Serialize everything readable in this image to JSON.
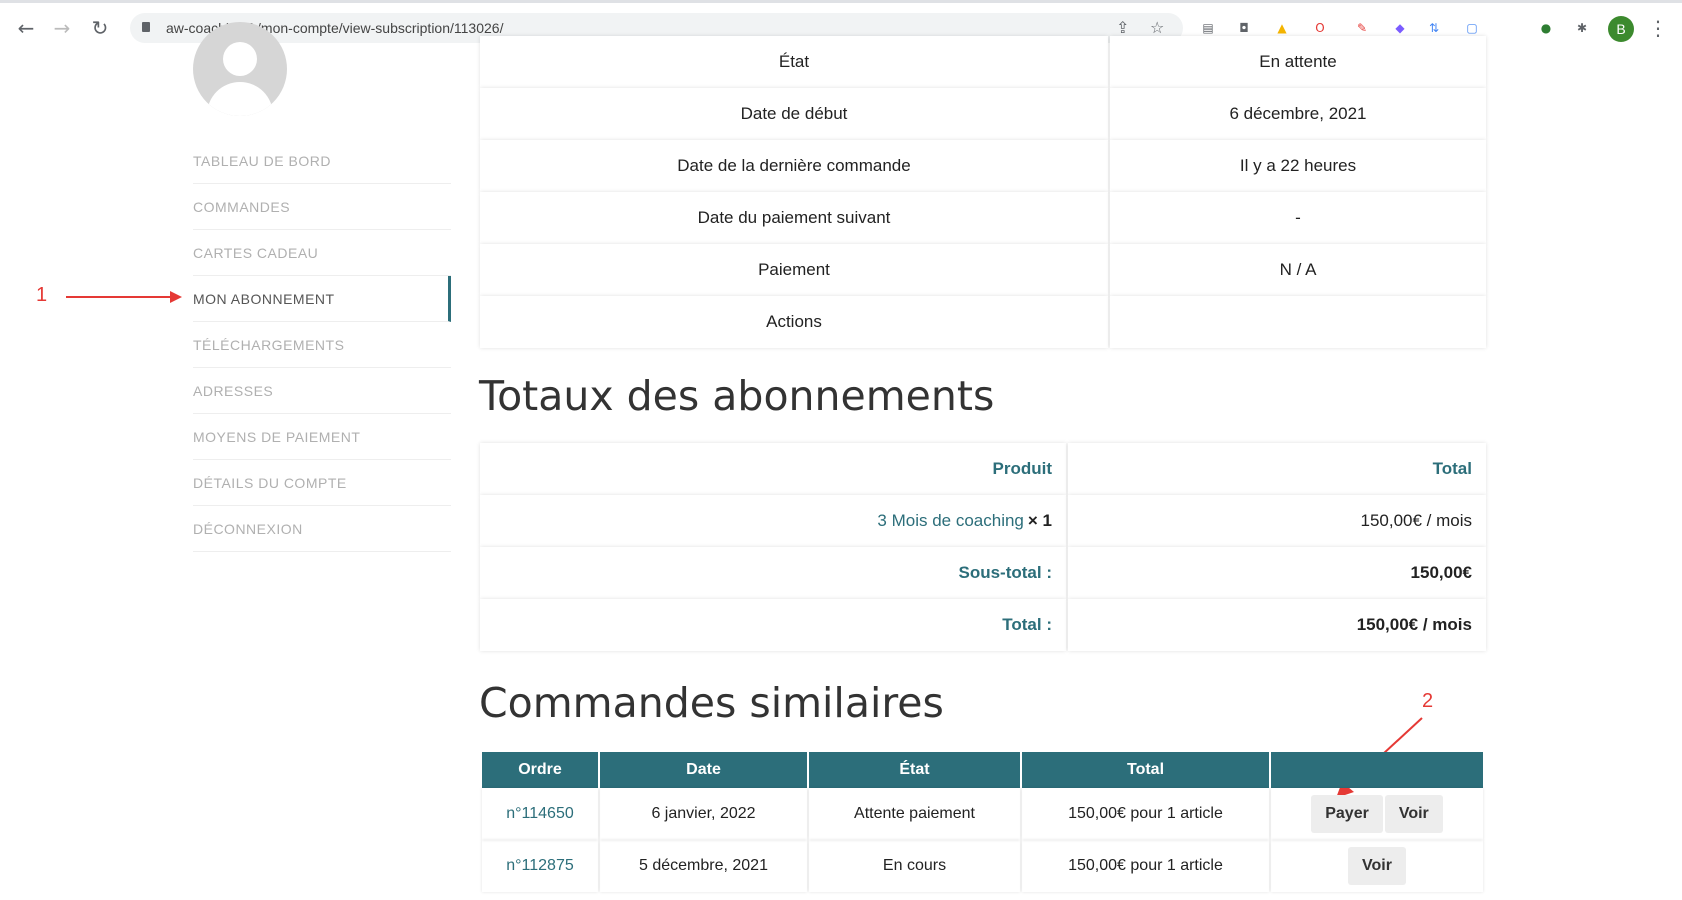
{
  "browser": {
    "url": "aw-coaching.fr/mon-compte/view-subscription/113026/",
    "profile_initial": "B"
  },
  "sidebar": {
    "items": [
      {
        "label": "TABLEAU DE BORD"
      },
      {
        "label": "COMMANDES"
      },
      {
        "label": "CARTES CADEAU"
      },
      {
        "label": "MON ABONNEMENT"
      },
      {
        "label": "TÉLÉCHARGEMENTS"
      },
      {
        "label": "ADRESSES"
      },
      {
        "label": "MOYENS DE PAIEMENT"
      },
      {
        "label": "DÉTAILS DU COMPTE"
      },
      {
        "label": "DÉCONNEXION"
      }
    ],
    "active_index": 3
  },
  "annotations": {
    "first": "1",
    "second": "2"
  },
  "subscription_details": [
    {
      "label": "État",
      "value": "En attente"
    },
    {
      "label": "Date de début",
      "value": "6 décembre, 2021"
    },
    {
      "label": "Date de la dernière commande",
      "value": "Il y a 22 heures"
    },
    {
      "label": "Date du paiement suivant",
      "value": "-"
    },
    {
      "label": "Paiement",
      "value": "N / A"
    },
    {
      "label": "Actions",
      "value": ""
    }
  ],
  "totals": {
    "title": "Totaux des abonnements",
    "header": {
      "product": "Produit",
      "total": "Total"
    },
    "product_name": "3 Mois de coaching",
    "product_qty": "× 1",
    "product_total": "150,00€ / mois",
    "subtotal_label": "Sous-total :",
    "subtotal_value": "150,00€",
    "total_label": "Total :",
    "total_value": "150,00€ / mois"
  },
  "orders": {
    "title": "Commandes similaires",
    "headers": [
      "Ordre",
      "Date",
      "État",
      "Total",
      ""
    ],
    "rows": [
      {
        "order": "n°114650",
        "date": "6 janvier, 2022",
        "status": "Attente paiement",
        "total": "150,00€ pour 1 article",
        "actions": [
          "Payer",
          "Voir"
        ]
      },
      {
        "order": "n°112875",
        "date": "5 décembre, 2021",
        "status": "En cours",
        "total": "150,00€ pour 1 article",
        "actions": [
          "Voir"
        ]
      }
    ]
  }
}
